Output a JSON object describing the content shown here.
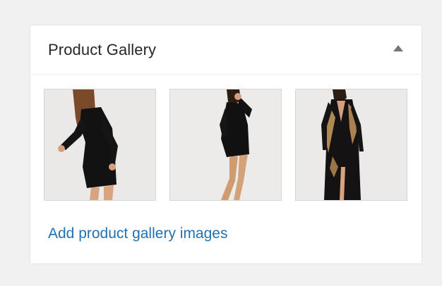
{
  "metabox": {
    "title": "Product Gallery",
    "toggle_icon": "triangle-up-icon",
    "add_link_label": "Add product gallery images",
    "images": [
      {
        "subject": "black-long-sleeve-bodycon-dress"
      },
      {
        "subject": "black-high-neck-mini-dress"
      },
      {
        "subject": "black-sequin-maxi-dress"
      }
    ]
  },
  "colors": {
    "background": "#f1f1f1",
    "panel": "#ffffff",
    "title_text": "#23282d",
    "link": "#2271b1",
    "toggle_icon": "#72777c",
    "thumb_background": "#eae8e6"
  }
}
